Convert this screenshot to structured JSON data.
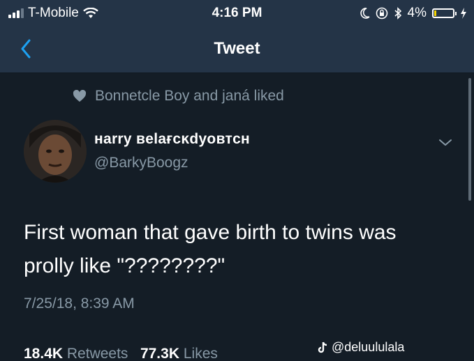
{
  "status_bar": {
    "carrier": "T-Mobile",
    "time": "4:16 PM",
    "battery": "4%",
    "battery_level": 0.04
  },
  "nav": {
    "title": "Tweet"
  },
  "tweet": {
    "social_context": "Bonnetcle Boy and janá liked",
    "display_name": "нarry вelaғcĸdyoвтcн",
    "username": "@BarkyBoogz",
    "text_line1": "First woman that gave birth to twins was",
    "text_line2": "prolly like \"????????\"",
    "timestamp": "7/25/18, 8:39 AM",
    "retweets_count": "18.4K",
    "retweets_label": "Retweets",
    "likes_count": "77.3K",
    "likes_label": "Likes"
  },
  "watermark": {
    "handle": "@deluululala"
  },
  "colors": {
    "background": "#141d26",
    "bar": "#243447",
    "accent": "#1da1f2",
    "secondary_text": "#8899a6"
  },
  "icons": {
    "back": "chevron-left-icon",
    "heart": "heart-icon",
    "caret": "chevron-down-icon",
    "tiktok": "tiktok-icon"
  }
}
